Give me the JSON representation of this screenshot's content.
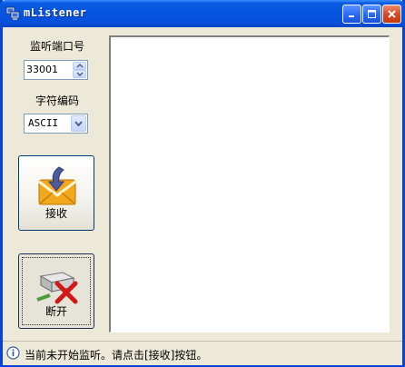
{
  "window": {
    "title": "mListener",
    "app_icon": "network-computers-icon",
    "controls": [
      "minimize-icon",
      "maximize-icon",
      "close-icon"
    ]
  },
  "port": {
    "label": "监听端口号",
    "value": "33001"
  },
  "encoding": {
    "label": "字符编码",
    "selected": "ASCII"
  },
  "buttons": {
    "receive": {
      "label": "接收",
      "icon": "envelope-receive-icon"
    },
    "disconnect": {
      "label": "断开",
      "icon": "disconnect-drive-icon"
    }
  },
  "output": {
    "text": ""
  },
  "status": {
    "icon": "info-icon",
    "text": "当前未开始监听。请点击[接收]按钮。"
  },
  "colors": {
    "titlebar": "#0754e1",
    "frame": "#0842d8",
    "face": "#ece9d8",
    "close_button": "#d9451c"
  }
}
